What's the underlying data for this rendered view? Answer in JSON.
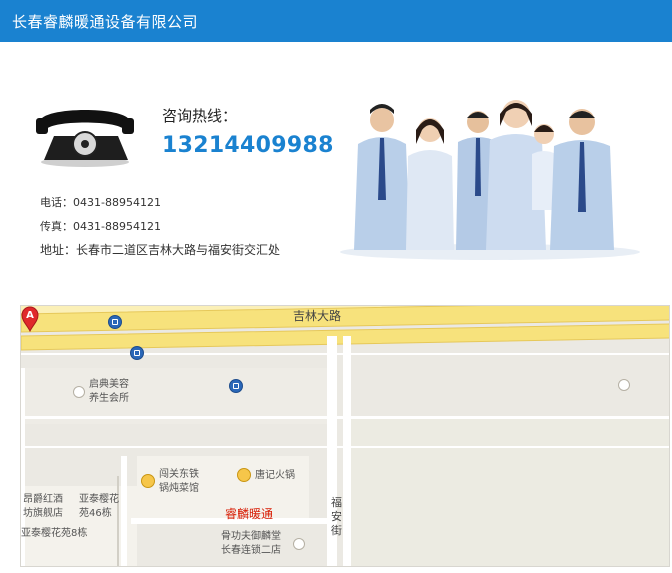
{
  "header": {
    "title": "长春睿麟暖通设备有限公司"
  },
  "contact": {
    "hotline_label": "咨询热线：",
    "hotline_number": "13214409988",
    "phone_line": "电话：0431-88954121",
    "fax_line": "传真：0431-88954121",
    "address_line": "地址：长春市二道区吉林大路与福安街交汇处"
  },
  "map": {
    "road_main": "吉林大路",
    "road_vertical": "福安街",
    "pois": {
      "beauty": "启典美容\n养生会所",
      "restaurant_1": "闯关东铁\n锅炖菜馆",
      "restaurant_2": "唐记火锅",
      "hotel": "昂爵红酒\n坊旗舰店",
      "block_1": "亚泰樱花\n苑46栋",
      "block_2": "亚泰樱花苑8栋",
      "target": "睿麟暖通",
      "clinic": "骨功夫御麟堂\n长春连锁二店"
    },
    "marker_letter": "A",
    "colors": {
      "road": "#f7e27c",
      "road_edge": "#e6c85a",
      "bg": "#ebe9e3",
      "block": "#f4f2ec",
      "marker": "#e0292b"
    }
  }
}
